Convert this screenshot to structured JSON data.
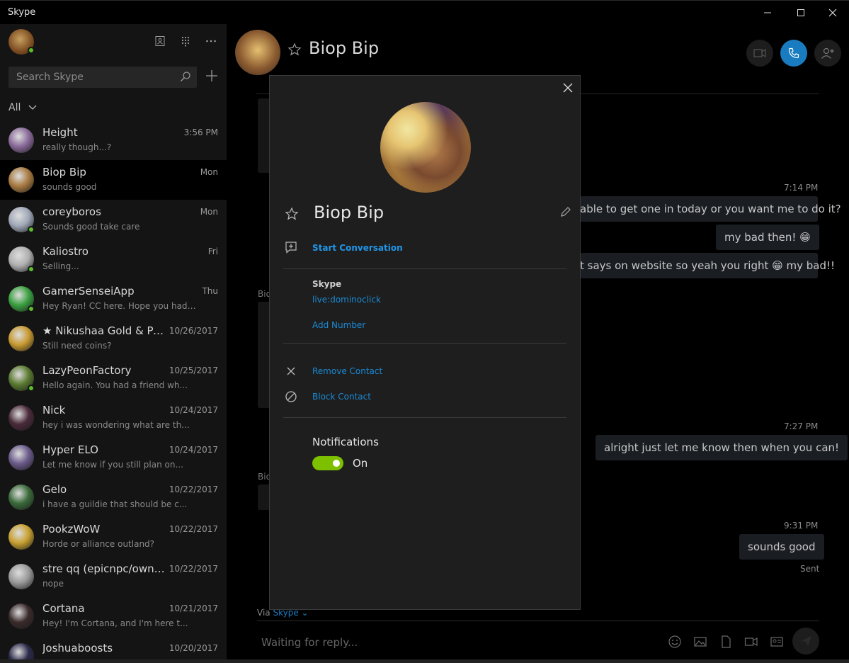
{
  "window": {
    "title": "Skype"
  },
  "sidebar": {
    "search_placeholder": "Search Skype",
    "filter_label": "All",
    "chats": [
      {
        "name": "Height",
        "time": "3:56 PM",
        "preview": "really though...?",
        "online": false,
        "color": "#8a6a9a"
      },
      {
        "name": "Biop Bip",
        "time": "Mon",
        "preview": "sounds good",
        "online": false,
        "color": "#a87a40",
        "active": true
      },
      {
        "name": "coreyboros",
        "time": "Mon",
        "preview": "Sounds good take care",
        "online": true,
        "color": "#a0a8b8"
      },
      {
        "name": "Kaliostro",
        "time": "Fri",
        "preview": "Selling...",
        "online": true,
        "color": "#b0b0b0"
      },
      {
        "name": "GamerSenseiApp",
        "time": "Thu",
        "preview": "Hey Ryan!  CC here. Hope you had a gr...",
        "online": true,
        "color": "#3aa040"
      },
      {
        "name": "★ Nikushaa Gold & Pow...",
        "time": "10/26/2017",
        "preview": "Still need coins?",
        "online": false,
        "color": "#c89a30"
      },
      {
        "name": "LazyPeonFactory",
        "time": "10/25/2017",
        "preview": "Hello again. You had a friend wh...",
        "online": true,
        "color": "#5a7a30"
      },
      {
        "name": "Nick",
        "time": "10/24/2017",
        "preview": "hey i was wondering what are th...",
        "online": false,
        "color": "#4a2a3a"
      },
      {
        "name": "Hyper ELO",
        "time": "10/24/2017",
        "preview": "Let me know if you still plan on...",
        "online": false,
        "color": "#6a5a8a"
      },
      {
        "name": "Gelo",
        "time": "10/22/2017",
        "preview": "i have a guildie that should be c...",
        "online": false,
        "color": "#3a6a3a"
      },
      {
        "name": "PookzWoW",
        "time": "10/22/2017",
        "preview": "Horde or alliance outland?",
        "online": false,
        "color": "#c8a030"
      },
      {
        "name": "stre qq  (epicnpc/owned...",
        "time": "10/22/2017",
        "preview": "nope",
        "online": false,
        "color": "#9a9a9a"
      },
      {
        "name": "Cortana",
        "time": "10/21/2017",
        "preview": "Hey! I'm Cortana, and I'm here t...",
        "online": false,
        "color": "#3a2a2a"
      },
      {
        "name": "Joshuaboosts",
        "time": "10/20/2017",
        "preview": "",
        "online": false,
        "color": "#2a2a4a"
      }
    ]
  },
  "conversation": {
    "contact_name": "Biop Bip",
    "messages": [
      {
        "time": "7:14 PM",
        "text": "able to get one in today or you want me to do it?"
      },
      {
        "text": "my bad then! 😁"
      },
      {
        "text": "t says on website so yeah you right 😁 my bad!!"
      },
      {
        "time": "7:27 PM",
        "text": "alright just let me know then when you can!"
      },
      {
        "time": "9:31 PM",
        "text": "sounds good"
      }
    ],
    "sent_label": "Sent",
    "side_name_1": "Bio",
    "side_name_2": "Bio",
    "via_prefix": "Via",
    "via_link": "Skype",
    "compose_placeholder": "Waiting for reply..."
  },
  "profile_modal": {
    "name": "Biop Bip",
    "start_conversation": "Start Conversation",
    "section_label": "Skype",
    "skype_id": "live:dominoclick",
    "add_number": "Add Number",
    "remove_contact": "Remove Contact",
    "block_contact": "Block Contact",
    "notifications_label": "Notifications",
    "notifications_state": "On",
    "toggle_color": "#7cc000"
  }
}
